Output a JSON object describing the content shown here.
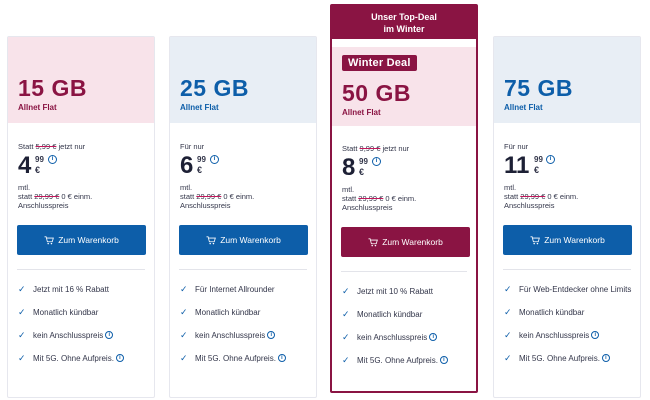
{
  "colors": {
    "brand_red": "#8a1443",
    "brand_blue": "#0d5ea9",
    "pink_bg": "#f8e3ea",
    "blue_bg": "#e8eef5"
  },
  "plans": [
    {
      "gb": "15 GB",
      "flat": "Allnet Flat",
      "prefix": "Statt",
      "old_price": "5,99 €",
      "suffix": "jetzt nur",
      "big": "4",
      "cents": "99",
      "currency": "€",
      "mtl": "mtl.",
      "statt": "statt",
      "old_setup": "29,99 €",
      "setup_text": "0 € einm.",
      "anschluss": "Anschlusspreis",
      "button": "Zum Warenkorb",
      "features": [
        "Jetzt mit 16 % Rabatt",
        "Monatlich kündbar",
        "kein Anschlusspreis",
        "Mit 5G. Ohne Aufpreis."
      ]
    },
    {
      "gb": "25 GB",
      "flat": "Allnet Flat",
      "prefix": "Für nur",
      "big": "6",
      "cents": "99",
      "currency": "€",
      "mtl": "mtl.",
      "statt": "statt",
      "old_setup": "29,99 €",
      "setup_text": "0 € einm.",
      "anschluss": "Anschlusspreis",
      "button": "Zum Warenkorb",
      "features": [
        "Für Internet Allrounder",
        "Monatlich kündbar",
        "kein Anschlusspreis",
        "Mit 5G. Ohne Aufpreis."
      ]
    },
    {
      "top_deal_line1": "Unser Top-Deal",
      "top_deal_line2": "im Winter",
      "badge": "Winter Deal",
      "gb": "50 GB",
      "flat": "Allnet Flat",
      "prefix": "Statt",
      "old_price": "9,99 €",
      "suffix": "jetzt nur",
      "big": "8",
      "cents": "99",
      "currency": "€",
      "mtl": "mtl.",
      "statt": "statt",
      "old_setup": "29,99 €",
      "setup_text": "0 € einm.",
      "anschluss": "Anschlusspreis",
      "button": "Zum Warenkorb",
      "features": [
        "Jetzt mit 10 % Rabatt",
        "Monatlich kündbar",
        "kein Anschlusspreis",
        "Mit 5G. Ohne Aufpreis."
      ]
    },
    {
      "gb": "75 GB",
      "flat": "Allnet Flat",
      "prefix": "Für nur",
      "big": "11",
      "cents": "99",
      "currency": "€",
      "mtl": "mtl.",
      "statt": "statt",
      "old_setup": "29,99 €",
      "setup_text": "0 € einm.",
      "anschluss": "Anschlusspreis",
      "button": "Zum Warenkorb",
      "features": [
        "Für Web-Entdecker ohne Limits",
        "Monatlich kündbar",
        "kein Anschlusspreis",
        "Mit 5G. Ohne Aufpreis."
      ]
    }
  ]
}
